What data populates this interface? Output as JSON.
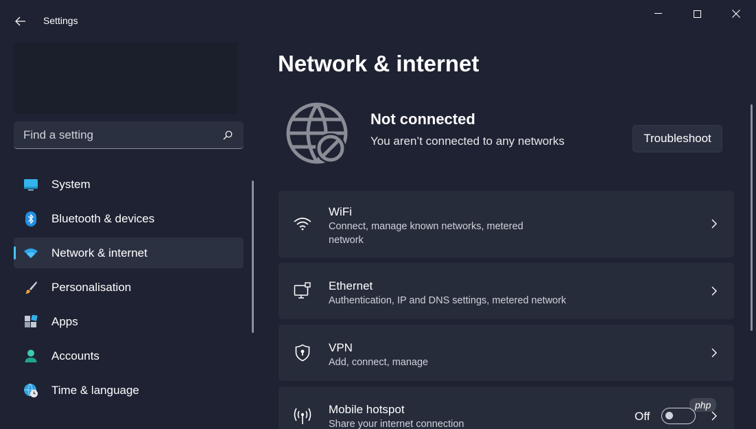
{
  "window": {
    "title": "Settings"
  },
  "search": {
    "placeholder": "Find a setting"
  },
  "sidebar": {
    "items": [
      {
        "label": "System",
        "icon": "system-icon"
      },
      {
        "label": "Bluetooth & devices",
        "icon": "bluetooth-icon"
      },
      {
        "label": "Network & internet",
        "icon": "network-icon",
        "active": true
      },
      {
        "label": "Personalisation",
        "icon": "paintbrush-icon"
      },
      {
        "label": "Apps",
        "icon": "apps-icon"
      },
      {
        "label": "Accounts",
        "icon": "person-icon"
      },
      {
        "label": "Time & language",
        "icon": "globe-clock-icon"
      }
    ]
  },
  "main": {
    "title": "Network & internet",
    "status": {
      "title": "Not connected",
      "subtitle": "You aren’t connected to any networks",
      "troubleshoot_label": "Troubleshoot"
    },
    "cards": [
      {
        "title": "WiFi",
        "subtitle": "Connect, manage known networks, metered network",
        "icon": "wifi-icon"
      },
      {
        "title": "Ethernet",
        "subtitle": "Authentication, IP and DNS settings, metered network",
        "icon": "ethernet-icon"
      },
      {
        "title": "VPN",
        "subtitle": "Add, connect, manage",
        "icon": "vpn-shield-icon"
      },
      {
        "title": "Mobile hotspot",
        "subtitle": "Share your internet connection",
        "icon": "hotspot-icon",
        "toggle_label": "Off",
        "toggle_on": false
      }
    ]
  },
  "watermark": "php",
  "colors": {
    "accent": "#4cc2ff",
    "background": "#1e2232",
    "card": "#272c3b"
  }
}
